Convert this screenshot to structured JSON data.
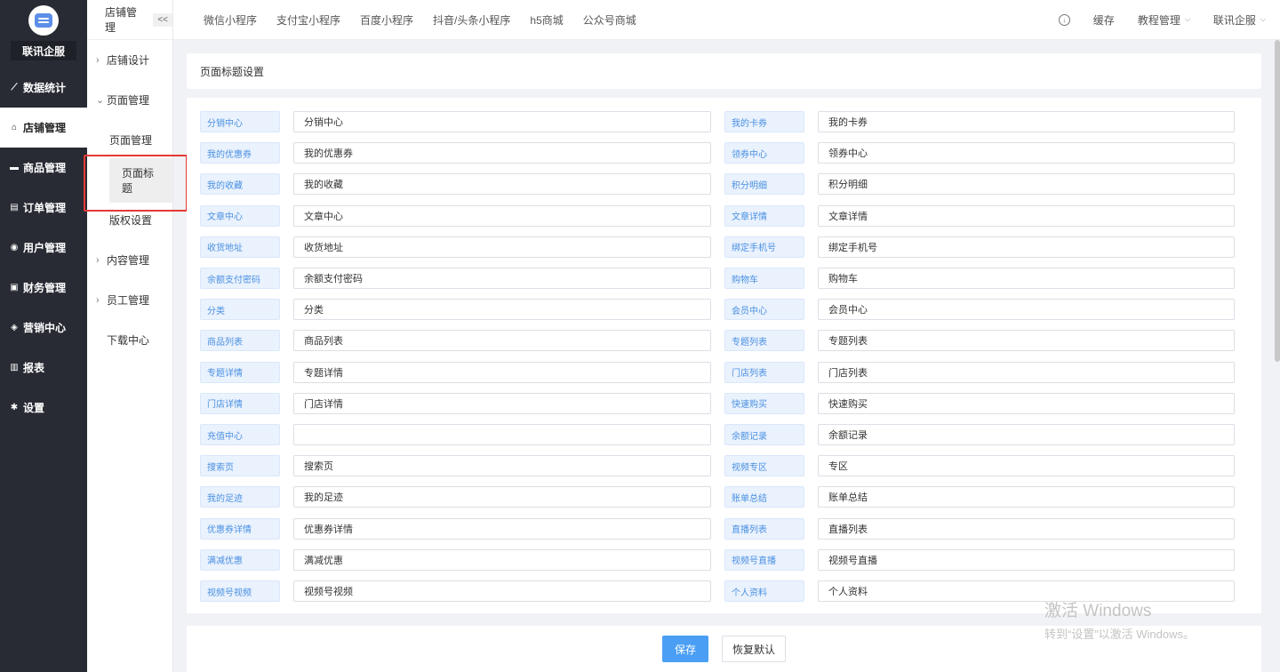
{
  "sidebar": {
    "brand": "联讯企服",
    "items": [
      {
        "label": "数据统计",
        "icon": "chart-line-icon"
      },
      {
        "label": "店铺管理",
        "icon": "shop-icon"
      },
      {
        "label": "商品管理",
        "icon": "goods-icon"
      },
      {
        "label": "订单管理",
        "icon": "order-icon"
      },
      {
        "label": "用户管理",
        "icon": "user-icon"
      },
      {
        "label": "财务管理",
        "icon": "finance-icon"
      },
      {
        "label": "营销中心",
        "icon": "marketing-icon"
      },
      {
        "label": "报表",
        "icon": "report-icon"
      },
      {
        "label": "设置",
        "icon": "settings-icon"
      }
    ],
    "active_index": 1
  },
  "subside": {
    "title": "店铺管理",
    "collapse": "<<",
    "items": [
      {
        "label": "店铺设计",
        "chev": "›"
      },
      {
        "label": "页面管理",
        "chev": "⌄"
      },
      {
        "label": "页面管理",
        "child": true
      },
      {
        "label": "页面标题",
        "child": true,
        "active": true
      },
      {
        "label": "版权设置",
        "child": true
      },
      {
        "label": "内容管理",
        "chev": "›"
      },
      {
        "label": "员工管理",
        "chev": "›"
      },
      {
        "label": "下载中心",
        "chev": ""
      }
    ]
  },
  "topbar": {
    "tabs": [
      "微信小程序",
      "支付宝小程序",
      "百度小程序",
      "抖音/头条小程序",
      "h5商城",
      "公众号商城"
    ],
    "cache": "缓存",
    "tutorial": "教程管理",
    "account": "联讯企服"
  },
  "panel": {
    "title": "页面标题设置"
  },
  "fields_left": [
    {
      "label": "分销中心",
      "value": "分销中心"
    },
    {
      "label": "我的优惠券",
      "value": "我的优惠券"
    },
    {
      "label": "我的收藏",
      "value": "我的收藏"
    },
    {
      "label": "文章中心",
      "value": "文章中心"
    },
    {
      "label": "收货地址",
      "value": "收货地址"
    },
    {
      "label": "余额支付密码",
      "value": "余额支付密码"
    },
    {
      "label": "分类",
      "value": "分类"
    },
    {
      "label": "商品列表",
      "value": "商品列表"
    },
    {
      "label": "专题详情",
      "value": "专题详情"
    },
    {
      "label": "门店详情",
      "value": "门店详情"
    },
    {
      "label": "充值中心",
      "value": ""
    },
    {
      "label": "搜索页",
      "value": "搜索页"
    },
    {
      "label": "我的足迹",
      "value": "我的足迹"
    },
    {
      "label": "优惠券详情",
      "value": "优惠券详情"
    },
    {
      "label": "满减优惠",
      "value": "满减优惠"
    },
    {
      "label": "视频号视频",
      "value": "视频号视频"
    }
  ],
  "fields_right": [
    {
      "label": "我的卡券",
      "value": "我的卡券"
    },
    {
      "label": "领券中心",
      "value": "领券中心"
    },
    {
      "label": "积分明细",
      "value": "积分明细"
    },
    {
      "label": "文章详情",
      "value": "文章详情"
    },
    {
      "label": "绑定手机号",
      "value": "绑定手机号"
    },
    {
      "label": "购物车",
      "value": "购物车"
    },
    {
      "label": "会员中心",
      "value": "会员中心"
    },
    {
      "label": "专题列表",
      "value": "专题列表"
    },
    {
      "label": "门店列表",
      "value": "门店列表"
    },
    {
      "label": "快速购买",
      "value": "快速购买"
    },
    {
      "label": "余额记录",
      "value": "余额记录"
    },
    {
      "label": "视频专区",
      "value": "专区"
    },
    {
      "label": "账单总结",
      "value": "账单总结"
    },
    {
      "label": "直播列表",
      "value": "直播列表"
    },
    {
      "label": "视频号直播",
      "value": "视频号直播"
    },
    {
      "label": "个人资料",
      "value": "个人资料"
    }
  ],
  "footer": {
    "save": "保存",
    "reset": "恢复默认"
  },
  "watermark": {
    "line1": "激活 Windows",
    "line2": "转到“设置”以激活 Windows。"
  }
}
